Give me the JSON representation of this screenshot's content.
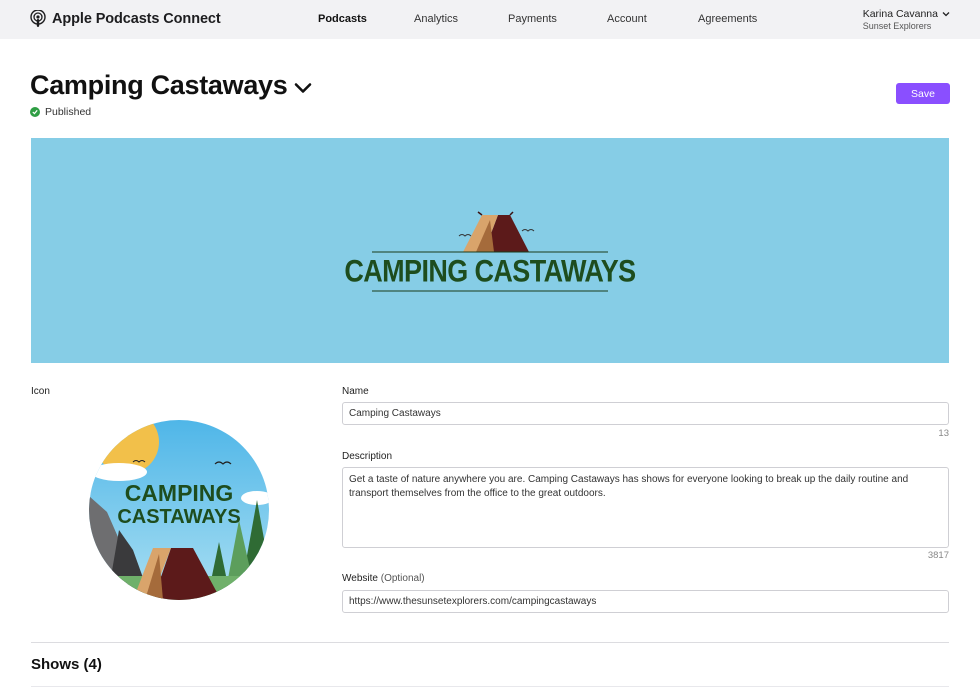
{
  "app": {
    "brand": "Apple Podcasts Connect",
    "brand_icon": "podcast-icon"
  },
  "nav": {
    "items": [
      {
        "label": "Podcasts",
        "active": true
      },
      {
        "label": "Analytics",
        "active": false
      },
      {
        "label": "Payments",
        "active": false
      },
      {
        "label": "Account",
        "active": false
      },
      {
        "label": "Agreements",
        "active": false
      }
    ]
  },
  "user": {
    "name": "Karina Cavanna",
    "org": "Sunset Explorers"
  },
  "page": {
    "title": "Camping Castaways",
    "status": "Published",
    "save_label": "Save"
  },
  "banner": {
    "logo_text": "CAMPING CASTAWAYS",
    "background": "#86cde6"
  },
  "form": {
    "icon_label": "Icon",
    "icon_art": {
      "line1": "CAMPING",
      "line2": "CASTAWAYS"
    },
    "name_label": "Name",
    "name_value": "Camping Castaways",
    "name_count": "13",
    "description_label": "Description",
    "description_value": "Get a taste of nature anywhere you are. Camping Castaways has shows for everyone looking to break up the daily routine and transport themselves from the office to the great outdoors.",
    "description_count": "3817",
    "website_label": "Website",
    "website_optional": "(Optional)",
    "website_value": "https://www.thesunsetexplorers.com/campingcastaways"
  },
  "shows": {
    "heading": "Shows (4)"
  },
  "colors": {
    "accent": "#8a4fff",
    "published": "#2f9e44",
    "nav_bg": "#f2f2f4"
  }
}
